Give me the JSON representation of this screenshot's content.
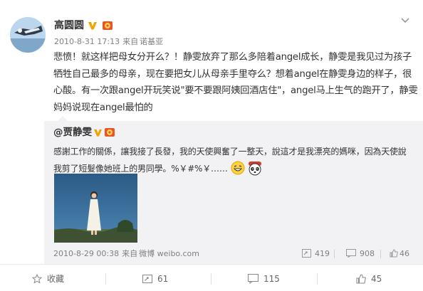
{
  "post": {
    "author": "高圆圆",
    "timestamp": "2010-8-31 17:13",
    "from_label": "来自",
    "device": "诺基亚",
    "text": "悲愤！就这样把母女分开么？！静雯放弃了那么多陪着angel成长，静雯是我见过为孩子牺牲自己最多的母亲，现在要把女儿从母亲手里夺么？想着angel在静雯身边的样子，很心酸。有一次跟angel开玩笑说\"要不要跟阿姨回酒店住\"，angel马上生气的跑开了，静雯妈妈说现在angel最怕的"
  },
  "repost": {
    "author": "@贾静雯",
    "text": "感謝工作的關係，讓我接了長發，我的天使興奮了一整天，說這才是我漂亮的媽咪，因為天使說我剪了短髮像她班上的男同學。%￥#%￥……",
    "timestamp": "2010-8-29 00:38",
    "from_label": "来自",
    "device": "微博 weibo.com",
    "reposts": "419",
    "comments": "908",
    "likes": "46"
  },
  "actions": {
    "favorite": "收藏",
    "forward": "61",
    "comment": "115",
    "like": "45"
  },
  "icons": {
    "verified": "verified-v-icon",
    "medal": "medal-badge-icon",
    "dropdown": "chevron-down-icon"
  },
  "colors": {
    "verified": "#f5a200",
    "repost_bg": "#f2f2f5",
    "meta_text": "#808080"
  }
}
